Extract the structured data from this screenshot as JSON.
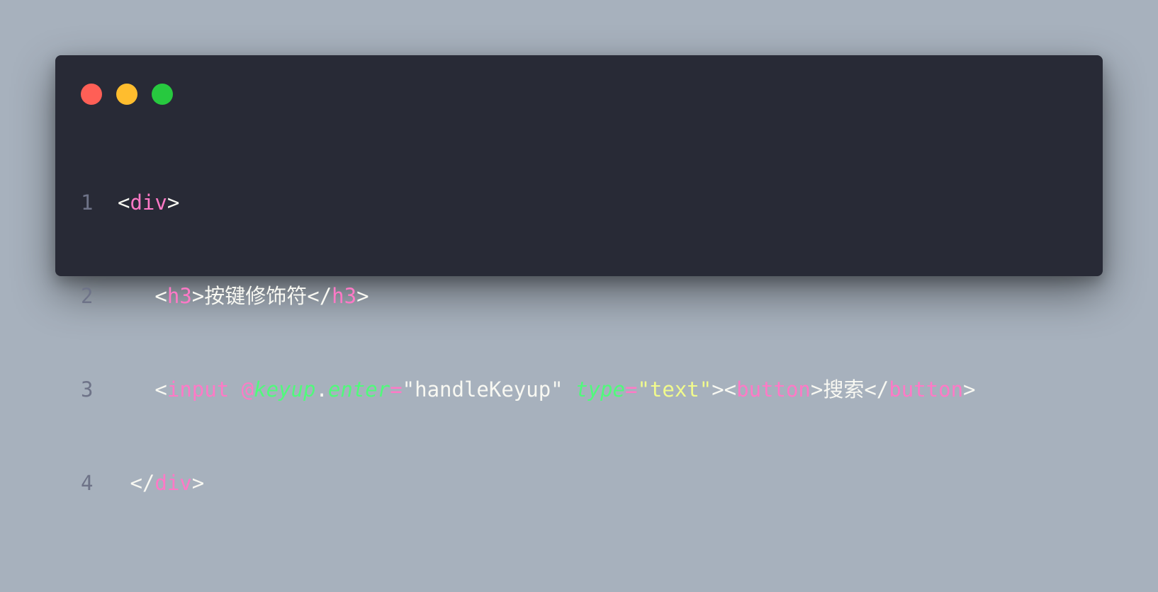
{
  "window": {
    "controls": [
      {
        "name": "close",
        "color": "#ff5f56"
      },
      {
        "name": "minimize",
        "color": "#ffbd2e"
      },
      {
        "name": "maximize",
        "color": "#27c93f"
      }
    ]
  },
  "code": {
    "lines": [
      {
        "number": "1",
        "indent": "",
        "tokens": [
          {
            "text": "<",
            "kind": "plain"
          },
          {
            "text": "div",
            "kind": "tag"
          },
          {
            "text": ">",
            "kind": "plain"
          }
        ]
      },
      {
        "number": "2",
        "indent": "   ",
        "tokens": [
          {
            "text": "<",
            "kind": "plain"
          },
          {
            "text": "h3",
            "kind": "tag"
          },
          {
            "text": ">按键修饰符</",
            "kind": "plain"
          },
          {
            "text": "h3",
            "kind": "tag"
          },
          {
            "text": ">",
            "kind": "plain"
          }
        ]
      },
      {
        "number": "3",
        "indent": "   ",
        "tokens": [
          {
            "text": "<",
            "kind": "plain"
          },
          {
            "text": "input",
            "kind": "tag"
          },
          {
            "text": " ",
            "kind": "plain"
          },
          {
            "text": "@",
            "kind": "tag"
          },
          {
            "text": "keyup",
            "kind": "attr"
          },
          {
            "text": ".",
            "kind": "plain"
          },
          {
            "text": "enter",
            "kind": "attr"
          },
          {
            "text": "=",
            "kind": "tag"
          },
          {
            "text": "\"handleKeyup\"",
            "kind": "plain"
          },
          {
            "text": " ",
            "kind": "plain"
          },
          {
            "text": "type",
            "kind": "attr"
          },
          {
            "text": "=",
            "kind": "tag"
          },
          {
            "text": "\"text\"",
            "kind": "str"
          },
          {
            "text": "><",
            "kind": "plain"
          },
          {
            "text": "button",
            "kind": "tag"
          },
          {
            "text": ">搜索</",
            "kind": "plain"
          },
          {
            "text": "button",
            "kind": "tag"
          },
          {
            "text": ">",
            "kind": "plain"
          }
        ]
      },
      {
        "number": "4",
        "indent": " ",
        "tokens": [
          {
            "text": "</",
            "kind": "plain"
          },
          {
            "text": "div",
            "kind": "tag"
          },
          {
            "text": ">",
            "kind": "plain"
          }
        ]
      }
    ]
  }
}
